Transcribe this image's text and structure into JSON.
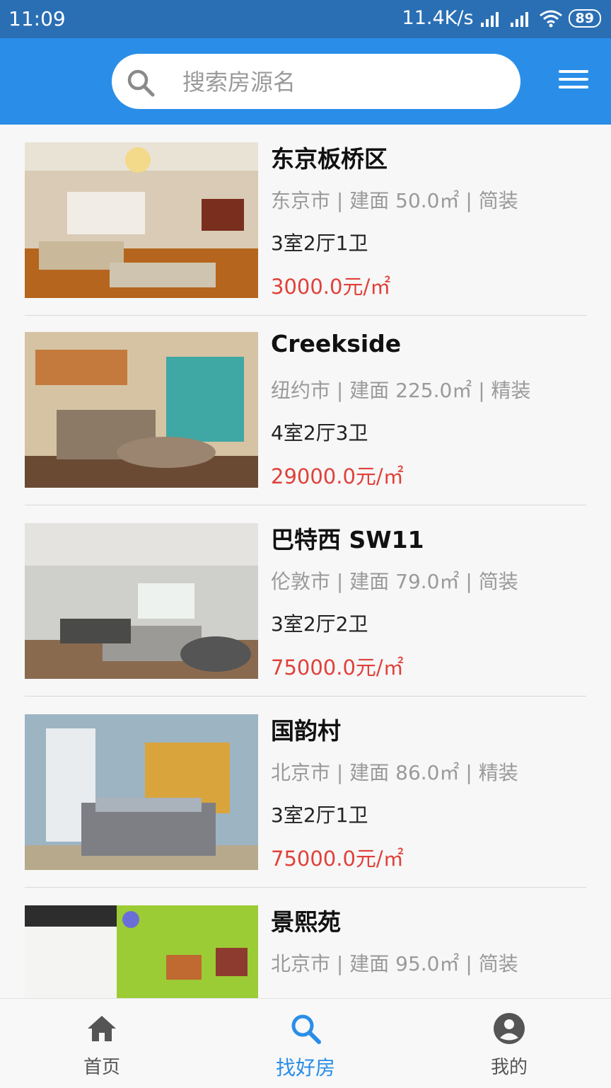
{
  "status_bar": {
    "time": "11:09",
    "speed": "11.4K/s",
    "battery": "89"
  },
  "search": {
    "placeholder": "搜索房源名"
  },
  "listings": [
    {
      "title": "东京板桥区",
      "meta": "东京市 | 建面 50.0㎡ | 简装",
      "layout": "3室2厅1卫",
      "price": "3000.0元/㎡"
    },
    {
      "title": "Creekside",
      "meta": "纽约市 | 建面 225.0㎡ | 精装",
      "layout": "4室2厅3卫",
      "price": "29000.0元/㎡"
    },
    {
      "title": "巴特西 SW11",
      "meta": "伦敦市 | 建面 79.0㎡ | 简装",
      "layout": "3室2厅2卫",
      "price": "75000.0元/㎡"
    },
    {
      "title": "国韵村",
      "meta": "北京市 | 建面 86.0㎡ | 精装",
      "layout": "3室2厅1卫",
      "price": "75000.0元/㎡"
    },
    {
      "title": "景熙苑",
      "meta": "北京市 | 建面 95.0㎡ | 简装",
      "layout": "",
      "price": ""
    }
  ],
  "nav": {
    "home": "首页",
    "find": "找好房",
    "mine": "我的"
  },
  "colors": {
    "header": "#2a8ee8",
    "status_bar": "#2a6fb4",
    "price": "#e0413b",
    "active": "#2a8ee8"
  },
  "icons": {
    "search": "search-icon",
    "menu": "menu-icon",
    "home": "home-icon",
    "find": "search-icon",
    "mine": "user-icon"
  }
}
